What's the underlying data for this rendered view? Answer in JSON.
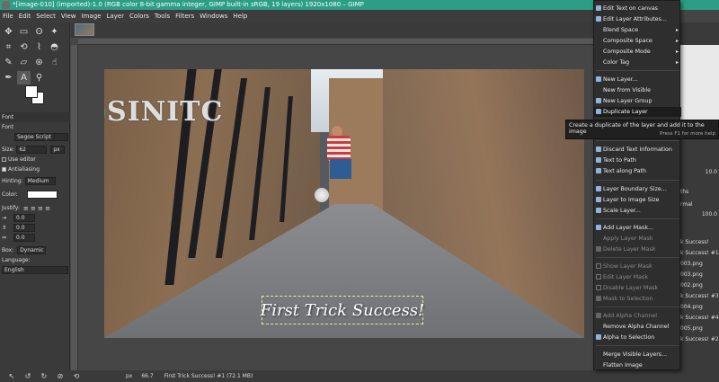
{
  "window": {
    "title": "*[image-010] (imported)-1.0 (RGB color 8-bit gamma integer, GIMP built-in sRGB, 19 layers) 1920x1080 – GIMP"
  },
  "menubar": [
    "File",
    "Edit",
    "Select",
    "View",
    "Image",
    "Layer",
    "Colors",
    "Tools",
    "Filters",
    "Windows",
    "Help"
  ],
  "tool_options": {
    "title": "Font",
    "font_label": "Font",
    "font_value": "Segoe Script",
    "size_label": "Size:",
    "size_value": "62",
    "size_unit": "px",
    "use_editor": "Use editor",
    "antialiasing": "Antialiasing",
    "hinting_label": "Hinting:",
    "hinting_value": "Medium",
    "color_label": "Color:",
    "justify_label": "Justify:",
    "indent_value": "0.0",
    "line_spacing_value": "0.0",
    "letter_spacing_value": "0.0",
    "box_label": "Box:",
    "box_value": "Dynamic",
    "language_label": "Language:",
    "language_value": "English"
  },
  "canvas": {
    "watermark": "SINITC",
    "caption": "First Trick Success!"
  },
  "statusbar": {
    "unit": "px",
    "zoom": "66.7",
    "layer_info": "First Trick Success! #1 (72.1 MB)"
  },
  "context_menu": {
    "items": [
      {
        "label": "Edit Text on canvas",
        "icon": "text-edit-icon"
      },
      {
        "label": "Edit Layer Attributes...",
        "icon": "layer-attr-icon"
      },
      {
        "label": "Blend Space",
        "submenu": true
      },
      {
        "label": "Composite Space",
        "submenu": true
      },
      {
        "label": "Composite Mode",
        "submenu": true
      },
      {
        "label": "Color Tag",
        "submenu": true
      },
      {
        "label": "New Layer...",
        "icon": "new-layer-icon"
      },
      {
        "label": "New from Visible"
      },
      {
        "label": "New Layer Group",
        "icon": "layer-group-icon"
      },
      {
        "label": "Duplicate Layer",
        "icon": "duplicate-icon",
        "highlighted": true
      },
      {
        "label": "Discard Text Information",
        "icon": "text-icon"
      },
      {
        "label": "Text to Path",
        "icon": "text-icon"
      },
      {
        "label": "Text along Path",
        "icon": "text-icon"
      },
      {
        "label": "Layer Boundary Size...",
        "icon": "resize-icon"
      },
      {
        "label": "Layer to Image Size",
        "icon": "resize-icon"
      },
      {
        "label": "Scale Layer...",
        "icon": "scale-icon"
      },
      {
        "label": "Add Layer Mask...",
        "icon": "mask-icon"
      },
      {
        "label": "Apply Layer Mask",
        "disabled": true
      },
      {
        "label": "Delete Layer Mask",
        "disabled": true,
        "icon": "delete-icon"
      },
      {
        "label": "Show Layer Mask",
        "disabled": true,
        "checkbox": true
      },
      {
        "label": "Edit Layer Mask",
        "disabled": true,
        "checkbox": true
      },
      {
        "label": "Disable Layer Mask",
        "disabled": true,
        "checkbox": true
      },
      {
        "label": "Mask to Selection",
        "disabled": true,
        "icon": "selection-icon"
      },
      {
        "label": "Add Alpha Channel",
        "disabled": true,
        "icon": "alpha-icon"
      },
      {
        "label": "Remove Alpha Channel"
      },
      {
        "label": "Alpha to Selection",
        "icon": "selection-icon"
      },
      {
        "label": "Merge Visible Layers..."
      },
      {
        "label": "Flatten Image"
      }
    ]
  },
  "tooltip": {
    "text": "Create a duplicate of the layer and add it to the image",
    "hint": "Press F1 for more help"
  },
  "dock": {
    "zoom_value": "10.0",
    "mode_partial": "rmal",
    "opacity_partial": "100.0",
    "tabs_partial": "ths",
    "layers": [
      "k Success!",
      "k Success! #1",
      "003.png",
      "003.png",
      "002.png",
      "k Success! #3",
      "004.png",
      "k Success! #4",
      "005.png",
      "k Success! #2"
    ]
  },
  "colors": {
    "titlebar": "#2b9f86",
    "menu_bg": "#2e2e2e",
    "menu_highlight": "#1c1c1c",
    "watermark_green": "#2faa62"
  }
}
